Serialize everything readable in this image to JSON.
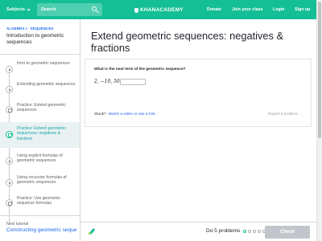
{
  "topnav": {
    "subjects_label": "Subjects",
    "search_placeholder": "Search",
    "logo_text": "KHANACADEMY",
    "donate": "Donate",
    "join_class": "Join your class",
    "login": "Login",
    "signup": "Sign up",
    "accent_color": "#14bf96"
  },
  "sidebar": {
    "breadcrumb": "ALGEBRA I · SEQUENCES",
    "title": "Introduction to geometric sequences",
    "items": [
      {
        "label": "Intro to geometric sequences",
        "type": "video",
        "active": false
      },
      {
        "label": "Extending geometric sequences",
        "type": "video",
        "active": false
      },
      {
        "label": "Practice: Extend geometric sequences",
        "type": "practice",
        "active": false
      },
      {
        "label": "Practice: Extend geometric sequences: negatives & fractions",
        "type": "practice",
        "active": true
      },
      {
        "label": "Using explicit formulas of geometric sequences",
        "type": "video",
        "active": false
      },
      {
        "label": "Using recursive formulas of geometric sequences",
        "type": "video",
        "active": false
      },
      {
        "label": "Practice: Use geometric sequence formulas",
        "type": "practice",
        "active": false
      }
    ],
    "next_label": "Next tutorial",
    "next_link": "Constructing geometric sequences"
  },
  "main": {
    "title": "Extend geometric sequences: negatives & fractions",
    "question": "What is the next term of the geometric sequence?",
    "sequence": "2, −10, 50, ",
    "answer_value": "",
    "stuck_label": "Stuck?",
    "hint_link": "Watch a video or use a hint.",
    "report_label": "Report a problem"
  },
  "footer": {
    "progress_text": "Do 5 problems",
    "total_problems": 5,
    "current_problem": 1,
    "check_label": "Check"
  }
}
